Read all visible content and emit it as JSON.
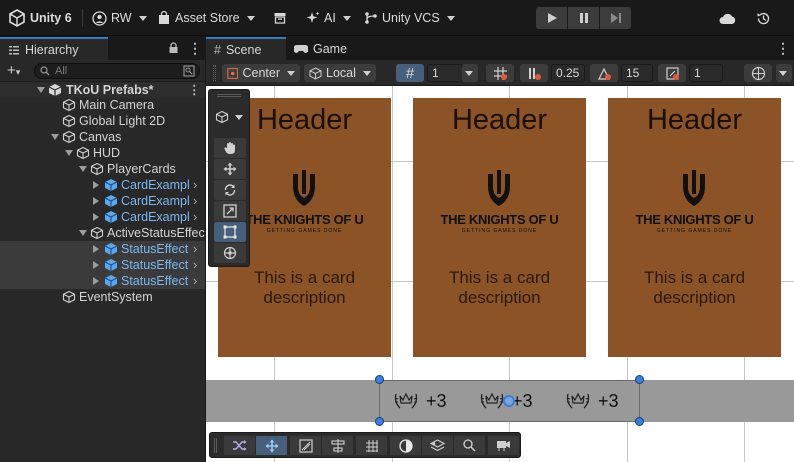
{
  "topbar": {
    "app_label": "Unity 6",
    "account_label": "RW",
    "asset_store_label": "Asset Store",
    "ai_label": "AI",
    "vcs_label": "Unity VCS"
  },
  "hierarchy": {
    "tab_label": "Hierarchy",
    "search_placeholder": "All",
    "scene_name": "TKoU Prefabs*",
    "rows": [
      {
        "label": "Main Camera"
      },
      {
        "label": "Global Light 2D"
      },
      {
        "label": "Canvas"
      },
      {
        "label": "HUD"
      },
      {
        "label": "PlayerCards"
      },
      {
        "label": "CardExampl"
      },
      {
        "label": "CardExampl"
      },
      {
        "label": "CardExampl"
      },
      {
        "label": "ActiveStatusEffec"
      },
      {
        "label": "StatusEffect"
      },
      {
        "label": "StatusEffect"
      },
      {
        "label": "StatusEffect"
      },
      {
        "label": "EventSystem"
      }
    ]
  },
  "scene": {
    "tab_scene": "Scene",
    "tab_game": "Game",
    "pivot_label": "Center",
    "space_label": "Local",
    "grid_value": "1",
    "snap_value": "0.25",
    "rotate_snap_value": "15",
    "scale_snap_value": "1"
  },
  "cards": [
    {
      "header": "Header",
      "logo_text": "THE KNIGHTS OF U",
      "logo_sub": "GETTING GAMES DONE",
      "description": "This is a card description"
    },
    {
      "header": "Header",
      "logo_text": "THE KNIGHTS OF U",
      "logo_sub": "GETTING GAMES DONE",
      "description": "This is a card description"
    },
    {
      "header": "Header",
      "logo_text": "THE KNIGHTS OF U",
      "logo_sub": "GETTING GAMES DONE",
      "description": "This is a card description"
    }
  ],
  "status_effects": [
    {
      "icon": "crown-laurel-icon",
      "value": "+3"
    },
    {
      "icon": "crown-laurel-icon",
      "value": "+3"
    },
    {
      "icon": "crown-laurel-icon",
      "value": "+3"
    }
  ],
  "colors": {
    "card": "#8b5326",
    "accent": "#3a79bb",
    "prefab_text": "#7cb7f0"
  }
}
